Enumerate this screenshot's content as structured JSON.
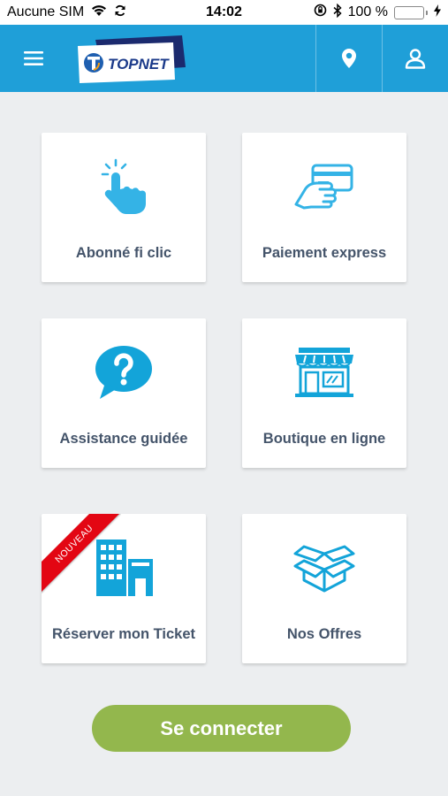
{
  "status_bar": {
    "carrier": "Aucune SIM",
    "time": "14:02",
    "battery": "100 %",
    "battery_level": 1.0
  },
  "app_bar": {
    "brand": "TOPNET",
    "brand_color": "#1f9fd8",
    "icons": [
      "menu-icon",
      "location-pin-icon",
      "user-icon"
    ]
  },
  "tiles": [
    {
      "label": "Abonné fi clic",
      "icon": "tap-hand-icon"
    },
    {
      "label": "Paiement express",
      "icon": "card-payment-icon"
    },
    {
      "label": "Assistance guidée",
      "icon": "question-bubble-icon"
    },
    {
      "label": "Boutique en ligne",
      "icon": "storefront-icon"
    },
    {
      "label": "Réserver mon Ticket",
      "icon": "building-icon",
      "badge": "NOUVEAU"
    },
    {
      "label": "Nos Offres",
      "icon": "open-box-icon"
    }
  ],
  "actions": {
    "connect_label": "Se connecter",
    "connect_color": "#93b74d"
  }
}
